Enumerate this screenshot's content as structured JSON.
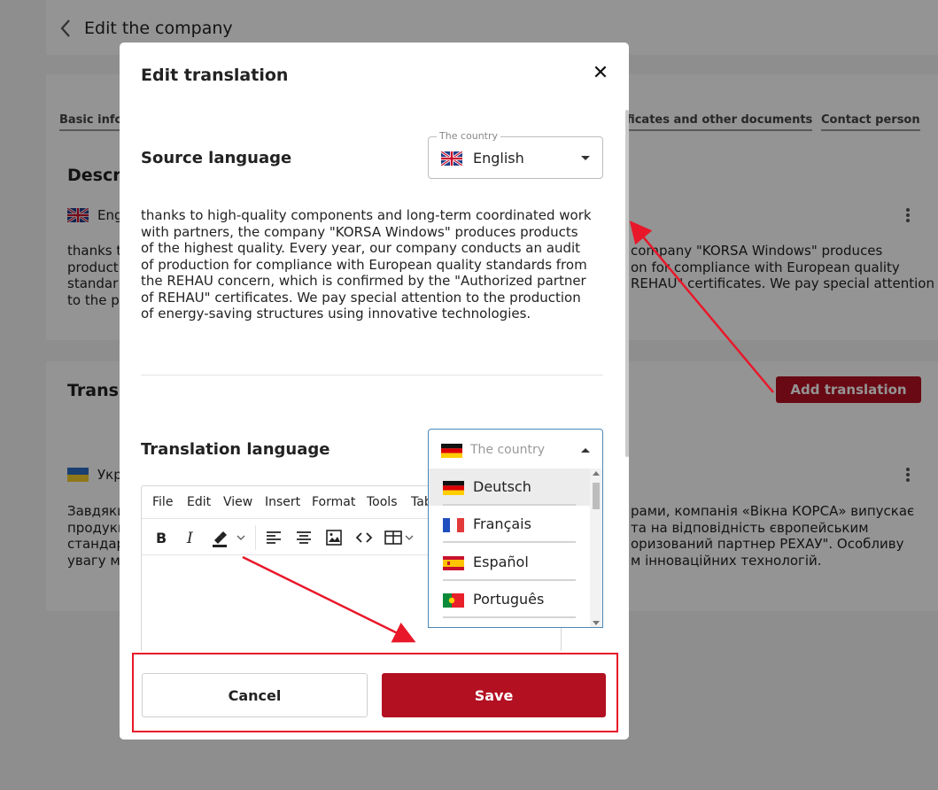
{
  "page": {
    "back_label": "Edit the company",
    "tabs": [
      "Basic infor",
      "rtificates and other documents",
      "Contact person"
    ],
    "description_heading": "Descr",
    "description_lang": "Eng",
    "description_left_lines": [
      "thanks t",
      "product",
      "standar",
      "to the p"
    ],
    "description_right_lines": [
      "company \"KORSA Windows\" produces",
      "on for compliance with European quality",
      "REHAU\" certificates. We pay special attention"
    ],
    "translations_heading": "Transl",
    "add_translation_label": "Add translation",
    "ukr_lang": "Укр",
    "ukr_left_lines": [
      "Завдяки",
      "продукц",
      "стандар",
      "увагу мі"
    ],
    "ukr_right_lines": [
      "рами, компанія «Вікна КОРСА» випускає",
      "та на відповідність європейським",
      "оризований партнер РЕХАУ\". Особливу",
      "м інноваційних технологій."
    ]
  },
  "modal": {
    "title": "Edit translation",
    "close_glyph": "✕",
    "source_label": "Source language",
    "source_select": {
      "legend": "The country",
      "value": "English"
    },
    "source_text": "thanks to high-quality components and long-term coordinated work with partners, the company \"KORSA Windows\" produces products of the highest quality. Every year, our company conducts an audit of production for compliance with European quality standards from the REHAU concern, which is confirmed by the \"Authorized partner of REHAU\" certificates. We pay special attention to the production of energy-saving structures using innovative technologies.",
    "translation_label": "Translation language",
    "translation_select": {
      "placeholder": "The country"
    },
    "editor_menu": [
      "File",
      "Edit",
      "View",
      "Insert",
      "Format",
      "Tools",
      "Tab"
    ],
    "dropdown_options": [
      "Deutsch",
      "Français",
      "Español",
      "Português"
    ],
    "cancel_label": "Cancel",
    "save_label": "Save"
  },
  "colors": {
    "accent": "#b31022",
    "annotation": "#e8182a"
  }
}
